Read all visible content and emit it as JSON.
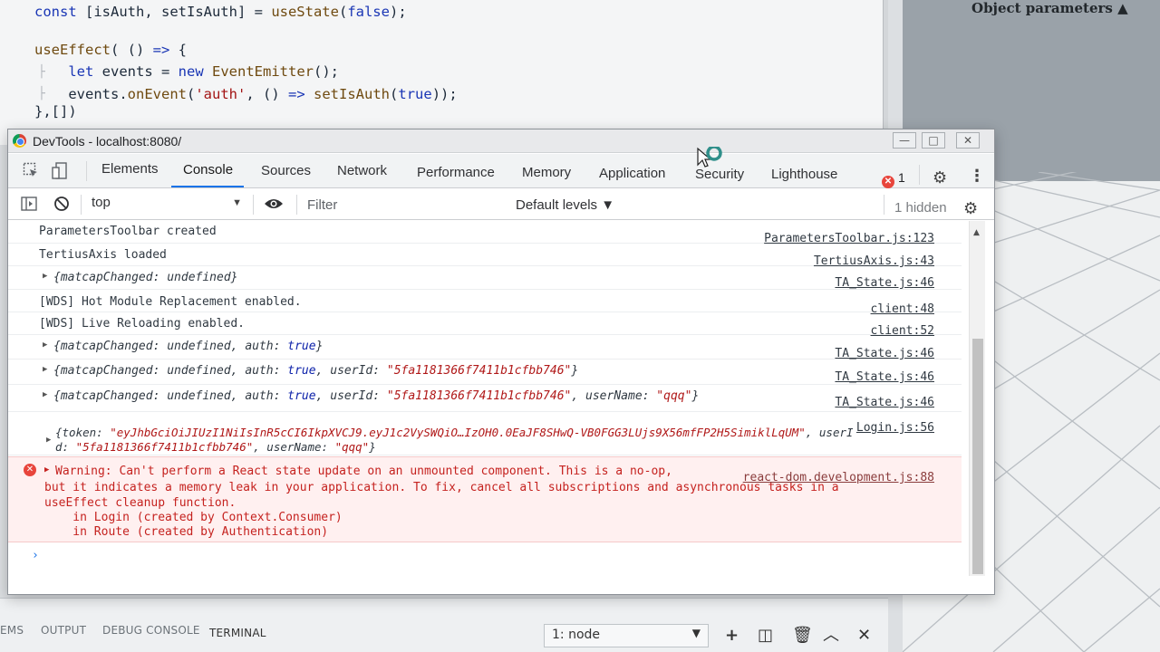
{
  "editor": {
    "lines": [
      "const [isAuth, setIsAuth] = useState(false);",
      "",
      "useEffect( () => {",
      "  let events = new EventEmitter();",
      "  events.onEvent('auth', () => setIsAuth(true));",
      "},[])"
    ]
  },
  "viewport": {
    "object_parameters": "Object parameters ▲"
  },
  "terminal": {
    "tabs": [
      "EMS",
      "OUTPUT",
      "DEBUG CONSOLE",
      "TERMINAL"
    ],
    "shell_select": "1: node",
    "icons": [
      "plus-icon",
      "split-icon",
      "trash-icon",
      "chevron-up-icon",
      "close-icon"
    ]
  },
  "devtools": {
    "title": "DevTools - localhost:8080/",
    "tabs": [
      "Elements",
      "Console",
      "Sources",
      "Network",
      "Performance",
      "Memory",
      "Application",
      "Security",
      "Lighthouse"
    ],
    "active_tab": "Console",
    "error_count": "1",
    "context": "top",
    "filter_placeholder": "Filter",
    "levels": "Default levels ▼",
    "hidden": "1 hidden"
  },
  "console": {
    "messages": [
      {
        "text": "ParametersToolbar created",
        "source": "ParametersToolbar.js:123"
      },
      {
        "text": "TertiusAxis loaded",
        "source": "TertiusAxis.js:43"
      },
      {
        "text": "{matcapChanged: undefined}",
        "source": "TA_State.js:46"
      },
      {
        "text": "[WDS] Hot Module Replacement enabled.",
        "source": "client:48"
      },
      {
        "text": "[WDS] Live Reloading enabled.",
        "source": "client:52"
      },
      {
        "text": "{matcapChanged: undefined, auth: true}",
        "source": "TA_State.js:46"
      },
      {
        "text": "{matcapChanged: undefined, auth: true, userId: \"5fa1181366f7411b1cfbb746\"}",
        "source": "TA_State.js:46"
      },
      {
        "text": "{matcapChanged: undefined, auth: true, userId: \"5fa1181366f7411b1cfbb746\", userName: \"qqq\"}",
        "source": "TA_State.js:46"
      },
      {
        "text_line1": "{token: \"eyJhbGciOiJIUzI1NiIsInR5cCI6IkpXVCJ9.eyJ1c2VySWQiO…IzOH0.0EaJF8SHwQ-VB0FGG3LUjs9X56mfFP2H5SimiklLqUM\", userI",
        "text_line2": "d: \"5fa1181366f7411b1cfbb746\", userName: \"qqq\"}",
        "source": "Login.js:56"
      }
    ],
    "warning": {
      "line1": "Warning: Can't perform a React state update on an unmounted component. This is a no-op,",
      "line2": "but it indicates a memory leak in your application. To fix, cancel all subscriptions and asynchronous tasks in a",
      "line3": "useEffect cleanup function.",
      "line4": "    in Login (created by Context.Consumer)",
      "line5": "    in Route (created by Authentication)",
      "source": "react-dom.development.js:88"
    },
    "prompt": "›"
  }
}
